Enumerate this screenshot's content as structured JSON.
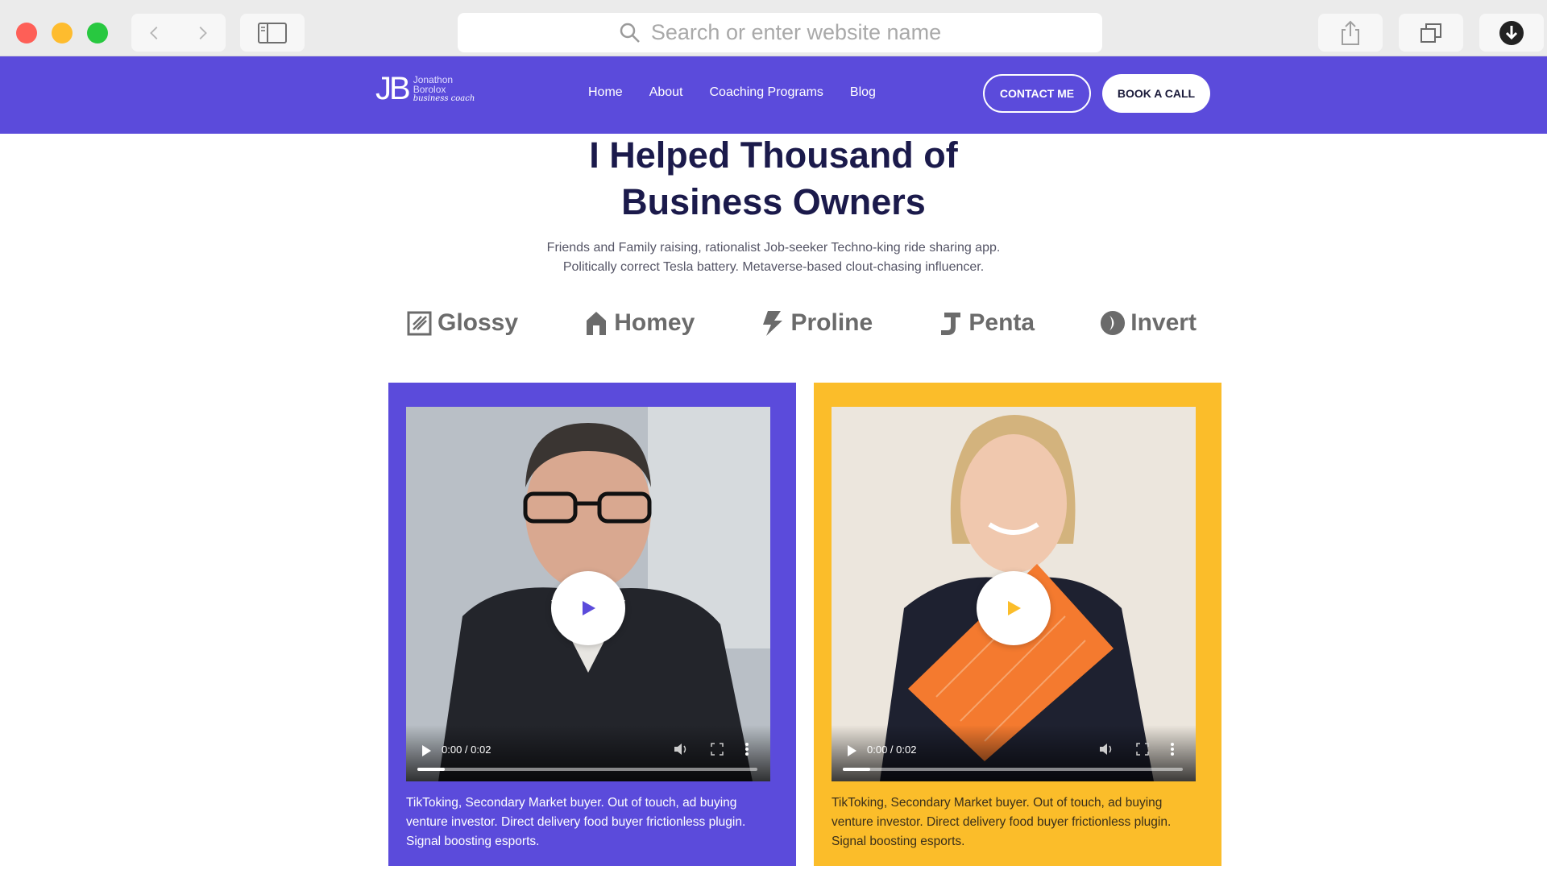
{
  "browser": {
    "address_placeholder": "Search or enter website name"
  },
  "header": {
    "logo_mark": "JB",
    "logo_line1": "Jonathon",
    "logo_line2": "Borolox",
    "logo_line3": "business coach",
    "nav": [
      "Home",
      "About",
      "Coaching Programs",
      "Blog"
    ],
    "contact_label": "CONTACT ME",
    "book_label": "BOOK A CALL"
  },
  "hero": {
    "title_line1": "I Helped Thousand of",
    "title_line2": "Business Owners",
    "subtitle_line1": "Friends and Family raising, rationalist Job-seeker Techno-king ride sharing app.",
    "subtitle_line2": "Politically correct Tesla battery. Metaverse-based clout-chasing influencer."
  },
  "brands": [
    "Glossy",
    "Homey",
    "Proline",
    "Penta",
    "Invert"
  ],
  "cards": [
    {
      "time": "0:00 / 0:02",
      "progress": 0.08,
      "text": "TikToking, Secondary Market buyer. Out of touch, ad buying venture investor. Direct delivery food buyer frictionless plugin. Signal boosting esports."
    },
    {
      "time": "0:00 / 0:02",
      "progress": 0.08,
      "text": "TikToking, Secondary Market buyer. Out of touch, ad buying venture investor. Direct delivery food buyer frictionless plugin. Signal boosting esports."
    }
  ],
  "colors": {
    "brand_purple": "#5b4bdb",
    "brand_yellow": "#fbbd2a",
    "title_navy": "#1b1a4b"
  }
}
